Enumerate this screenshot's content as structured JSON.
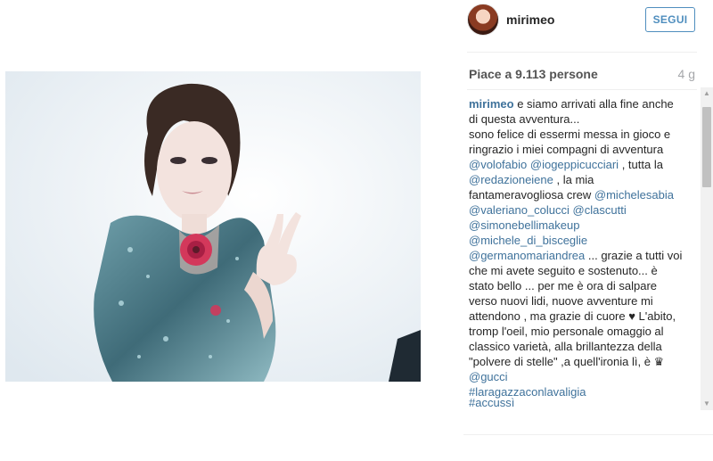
{
  "header": {
    "username": "mirimeo",
    "follow_label": "SEGUI"
  },
  "stats": {
    "likes": "Piace a 9.113 persone",
    "time_ago": "4 g"
  },
  "caption": {
    "lines": [
      [
        {
          "t": "mirimeo",
          "c": "u b"
        },
        {
          "t": " e siamo arrivati alla fine anche"
        }
      ],
      [
        {
          "t": "di questa avventura..."
        }
      ],
      [
        {
          "t": "sono felice di essermi messa in gioco e"
        }
      ],
      [
        {
          "t": "ringrazio i miei compagni di avventura"
        }
      ],
      [
        {
          "t": "@volofabio",
          "c": "u"
        },
        {
          "t": " "
        },
        {
          "t": "@iogeppicucciari",
          "c": "u"
        },
        {
          "t": " , tutta la"
        }
      ],
      [
        {
          "t": "@redazioneiene",
          "c": "u"
        },
        {
          "t": " , la mia"
        }
      ],
      [
        {
          "t": "fantameravogliosa crew "
        },
        {
          "t": "@michelesabia",
          "c": "u"
        }
      ],
      [
        {
          "t": "@valeriano_colucci",
          "c": "u"
        },
        {
          "t": " "
        },
        {
          "t": "@clascutti",
          "c": "u"
        }
      ],
      [
        {
          "t": "@simonebellimakeup",
          "c": "u"
        }
      ],
      [
        {
          "t": "@michele_di_bisceglie",
          "c": "u"
        }
      ],
      [
        {
          "t": "@germanomariandrea",
          "c": "u"
        },
        {
          "t": " ... grazie a tutti voi"
        }
      ],
      [
        {
          "t": "che mi avete seguito e sostenuto... è"
        }
      ],
      [
        {
          "t": "stato bello ... per me è ora di salpare"
        }
      ],
      [
        {
          "t": "verso nuovi lidi, nuove avventure mi"
        }
      ],
      [
        {
          "t": "attendono , ma grazie di cuore ♥ L'abito,"
        }
      ],
      [
        {
          "t": "tromp l'oeil, mio personale omaggio al"
        }
      ],
      [
        {
          "t": "classico varietà, alla brillantezza della"
        }
      ],
      [
        {
          "t": "\"polvere di stelle\" ,a quell'ironia lì, è ♛"
        }
      ],
      [
        {
          "t": "@gucci",
          "c": "u"
        }
      ],
      [
        {
          "t": "#laragazzaconlavaligia",
          "c": "u"
        }
      ]
    ],
    "last_hashtag": "#accussì"
  }
}
